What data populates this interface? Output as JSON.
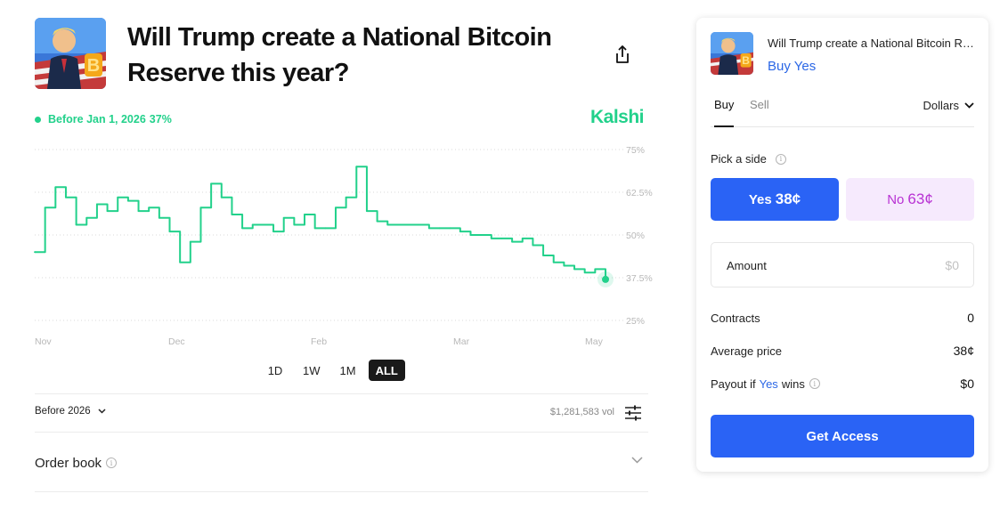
{
  "market": {
    "title": "Will Trump create a National Bitcoin Reserve this year?",
    "share_icon": "share-icon",
    "thumbnail_icon": "market-thumbnail"
  },
  "chart": {
    "legend_date": "Before Jan 1, 2026",
    "legend_value": "37%",
    "brand": "Kalshi",
    "accent_color": "#22d18b"
  },
  "chart_data": {
    "type": "line",
    "series": [
      {
        "name": "Before Jan 1, 2026",
        "x": [
          "Oct 30",
          "Nov 3",
          "Nov 6",
          "Nov 10",
          "Nov 13",
          "Nov 16",
          "Nov 20",
          "Nov 23",
          "Nov 26",
          "Nov 30",
          "Dec 3",
          "Dec 7",
          "Dec 10",
          "Dec 13",
          "Dec 16",
          "Dec 19",
          "Dec 23",
          "Dec 26",
          "Dec 30",
          "Jan 2",
          "Jan 6",
          "Jan 9",
          "Jan 13",
          "Jan 16",
          "Jan 19",
          "Jan 23",
          "Jan 26",
          "Jan 29",
          "Feb 2",
          "Feb 5",
          "Feb 8",
          "Feb 12",
          "Feb 15",
          "Feb 18",
          "Feb 22",
          "Feb 25",
          "Mar 1",
          "Mar 4",
          "Mar 8",
          "Mar 11",
          "Mar 15",
          "Mar 18",
          "Mar 22",
          "Mar 25",
          "Mar 29",
          "Apr 1",
          "Apr 5",
          "Apr 8",
          "Apr 12",
          "Apr 15",
          "Apr 19",
          "Apr 22",
          "Apr 26",
          "Apr 29",
          "May 3",
          "May 6"
        ],
        "values": [
          45,
          58,
          64,
          61,
          53,
          55,
          59,
          57,
          61,
          60,
          57,
          58,
          55,
          51,
          42,
          48,
          58,
          65,
          61,
          56,
          52,
          53,
          53,
          51,
          55,
          53,
          56,
          52,
          52,
          58,
          61,
          70,
          57,
          54,
          53,
          53,
          53,
          53,
          52,
          52,
          52,
          51,
          50,
          50,
          49,
          49,
          48,
          49,
          47,
          44,
          42,
          41,
          40,
          39,
          40,
          37
        ]
      }
    ],
    "x_ticks": [
      "Nov",
      "Dec",
      "Feb",
      "Mar",
      "May"
    ],
    "y_ticks": [
      "75%",
      "62.5%",
      "50%",
      "37.5%",
      "25%"
    ],
    "ylim": [
      25,
      75
    ],
    "ylabel": "",
    "xlabel": "",
    "grid": "horizontal dotted"
  },
  "ranges": [
    "1D",
    "1W",
    "1M",
    "ALL"
  ],
  "active_range": "ALL",
  "outcome_select": "Before 2026",
  "volume": "$1,281,583 vol",
  "order_book": {
    "label": "Order book"
  },
  "panel": {
    "title": "Will Trump create a National Bitcoin Reserve this year?",
    "action": "Buy Yes",
    "tabs": [
      "Buy",
      "Sell"
    ],
    "active_tab": "Buy",
    "unit": "Dollars",
    "pick_side": "Pick a side",
    "yes_label": "Yes",
    "yes_price": "38¢",
    "no_label": "No",
    "no_price": "63¢",
    "amount_label": "Amount",
    "amount_placeholder": "$0",
    "contracts_label": "Contracts",
    "contracts_value": "0",
    "avg_price_label": "Average price",
    "avg_price_value": "38¢",
    "payout_prefix": "Payout if",
    "payout_yes": "Yes",
    "payout_suffix": "wins",
    "payout_value": "$0",
    "cta": "Get Access",
    "primary_color": "#2a63f5",
    "no_color": "#b832d3"
  }
}
